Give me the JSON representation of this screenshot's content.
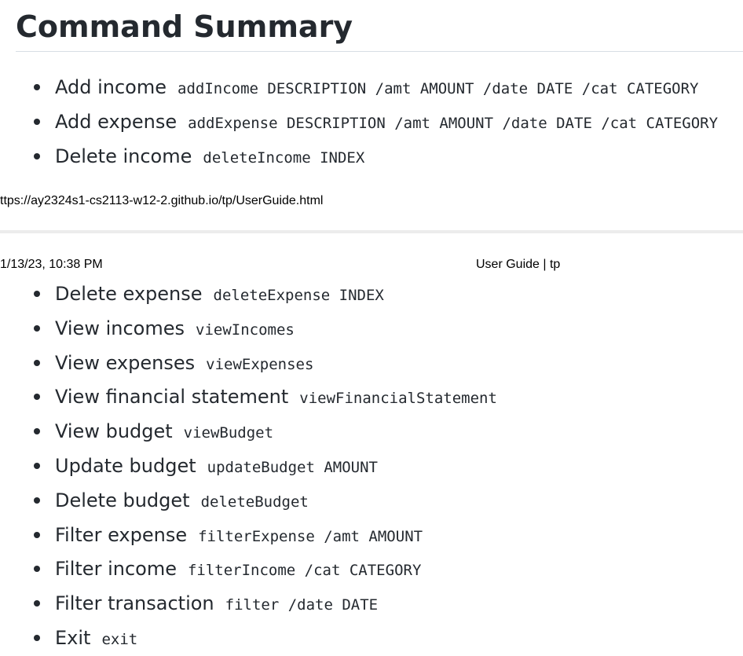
{
  "heading": "Command Summary",
  "page1": {
    "commands": [
      {
        "label": "Add income",
        "code": "addIncome DESCRIPTION /amt AMOUNT /date DATE /cat CATEGORY"
      },
      {
        "label": "Add expense",
        "code": "addExpense DESCRIPTION /amt AMOUNT /date DATE /cat CATEGORY"
      },
      {
        "label": "Delete income",
        "code": "deleteIncome INDEX"
      }
    ]
  },
  "print_footer": {
    "url": "ttps://ay2324s1-cs2113-w12-2.github.io/tp/UserGuide.html"
  },
  "print_header": {
    "date": "1/13/23, 10:38 PM",
    "title": "User Guide | tp"
  },
  "page2": {
    "commands": [
      {
        "label": "Delete expense",
        "code": "deleteExpense INDEX"
      },
      {
        "label": "View incomes",
        "code": "viewIncomes"
      },
      {
        "label": "View expenses",
        "code": "viewExpenses"
      },
      {
        "label": "View financial statement",
        "code": "viewFinancialStatement"
      },
      {
        "label": "View budget",
        "code": "viewBudget"
      },
      {
        "label": "Update budget",
        "code": "updateBudget AMOUNT"
      },
      {
        "label": "Delete budget",
        "code": "deleteBudget"
      },
      {
        "label": "Filter expense",
        "code": "filterExpense /amt AMOUNT"
      },
      {
        "label": "Filter income",
        "code": "filterIncome /cat CATEGORY"
      },
      {
        "label": "Filter transaction",
        "code": "filter /date DATE"
      },
      {
        "label": "Exit",
        "code": "exit"
      }
    ]
  }
}
